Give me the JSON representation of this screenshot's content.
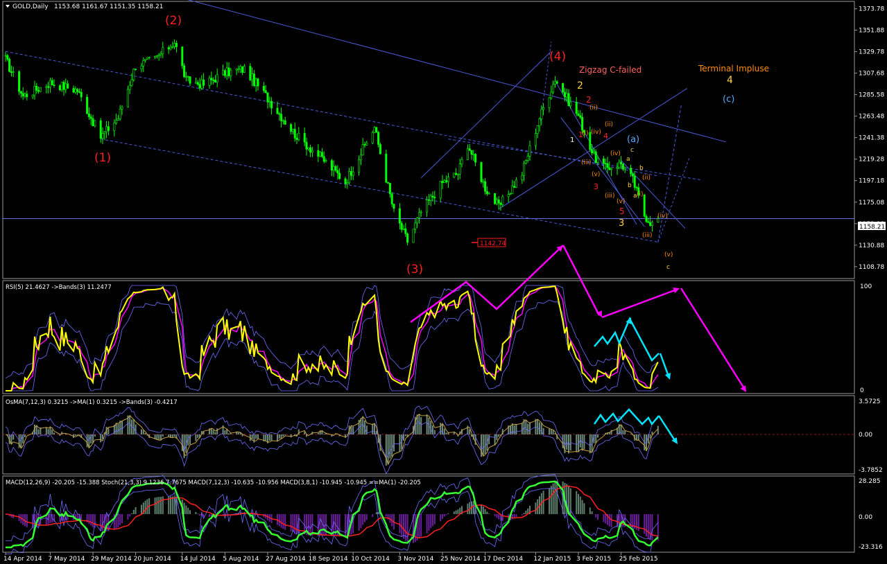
{
  "symbol_label": "GOLD,Daily",
  "ohlc_label": "1153.68 1161.67 1151.35 1158.21",
  "colors": {
    "bull": "#00ff00",
    "bear": "#00ff00",
    "channel": "#4a5bd6",
    "rsi": "#ffff00",
    "rsi_ma": "#ff00ff",
    "bands": "#6f6fff",
    "cyan": "#00e5ff",
    "magenta": "#ff00ff",
    "wave_red": "#ff0000",
    "wave_orange": "#ff8c00",
    "wave_yellow": "#ffd23f",
    "wave_blue": "#55aaff",
    "macd_green": "#33ff33",
    "macd_red": "#ff2020"
  },
  "chart_data": [
    {
      "type": "candlestick",
      "name": "price",
      "ylim": [
        1098,
        1380
      ],
      "yticks": [
        "1373.78",
        "1351.88",
        "1329.78",
        "1307.68",
        "1285.58",
        "1263.48",
        "1241.38",
        "1219.28",
        "1197.18",
        "1175.08",
        "1152.98",
        "1130.88",
        "1108.78"
      ],
      "current_price_label": "1158.21",
      "current_price": 1158.21,
      "low_label": "1142.74",
      "low_value": 1142.74,
      "x_dates": [
        "14 Apr 2014",
        "7 May 2014",
        "29 May 2014",
        "20 Jun 2014",
        "14 Jul 2014",
        "5 Aug 2014",
        "27 Aug 2014",
        "18 Sep 2014",
        "10 Oct 2014",
        "3 Nov 2014",
        "25 Nov 2014",
        "17 Dec 2014",
        "12 Jan 2015",
        "3 Feb 2015",
        "25 Feb 2015"
      ],
      "anchors": [
        [
          "14 Apr 2014",
          1322
        ],
        [
          "23 Apr 2014",
          1284
        ],
        [
          "7 May 2014",
          1298
        ],
        [
          "21 May 2014",
          1290
        ],
        [
          "2 Jun 2014",
          1242
        ],
        [
          "11 Jun 2014",
          1262
        ],
        [
          "20 Jun 2014",
          1316
        ],
        [
          "30 Jun 2014",
          1322
        ],
        [
          "10 Jul 2014",
          1340
        ],
        [
          "16 Jul 2014",
          1300
        ],
        [
          "25 Jul 2014",
          1296
        ],
        [
          "5 Aug 2014",
          1308
        ],
        [
          "15 Aug 2014",
          1312
        ],
        [
          "27 Aug 2014",
          1282
        ],
        [
          "10 Sep 2014",
          1245
        ],
        [
          "24 Sep 2014",
          1220
        ],
        [
          "6 Oct 2014",
          1196
        ],
        [
          "21 Oct 2014",
          1252
        ],
        [
          "31 Oct 2014",
          1165
        ],
        [
          "7 Nov 2014",
          1135
        ],
        [
          "14 Nov 2014",
          1165
        ],
        [
          "25 Nov 2014",
          1195
        ],
        [
          "3 Dec 2014",
          1205
        ],
        [
          "8 Dec 2014",
          1235
        ],
        [
          "17 Dec 2014",
          1190
        ],
        [
          "24 Dec 2014",
          1170
        ],
        [
          "5 Jan 2015",
          1205
        ],
        [
          "14 Jan 2015",
          1262
        ],
        [
          "22 Jan 2015",
          1302
        ],
        [
          "28 Jan 2015",
          1282
        ],
        [
          "3 Feb 2015",
          1264
        ],
        [
          "11 Feb 2015",
          1222
        ],
        [
          "17 Feb 2015",
          1210
        ],
        [
          "25 Feb 2015",
          1215
        ],
        [
          "3 Mar 2015",
          1198
        ],
        [
          "9 Mar 2015",
          1162
        ],
        [
          "13 Mar 2015",
          1153
        ],
        [
          "16 Mar 2015",
          1158
        ]
      ],
      "annotations": {
        "wave_1": "(1)",
        "wave_2": "(2)",
        "wave_3": "(3)",
        "wave_4": "(4)",
        "zigzag": "Zigzag C-failed",
        "terminal": "Terminal Impluse",
        "terminal_4": "4",
        "wave_a": "(a)",
        "wave_c": "(c)",
        "small_2_yellow": "2",
        "small_2_red": "2",
        "small_ii": "(ii)",
        "small_1_white": "1",
        "small_i_a": "(i)",
        "small_1_red": "1",
        "small_iv_a": "(iv)",
        "small_ii_b": "(ii)",
        "small_4_red": "4",
        "small_c": "c",
        "small_iii_a": "(iii)",
        "small_a": "a",
        "small_iv_b": "(iv)",
        "small_v_a": "(v)",
        "small_b": "b",
        "small_ii_c": "(ii)",
        "small_3_red": "3",
        "small_iii_b": "(iii)",
        "small_v_b": "(v)",
        "small_b2": "b",
        "small_i_b": "(i)",
        "small_a2": "a",
        "small_5_red": "5",
        "small_3_yellow": "3",
        "small_iv_c": "(iv)",
        "small_iii_c": "(iii)",
        "small_v_c": "(v)",
        "small_c2": "c"
      }
    },
    {
      "type": "line",
      "name": "rsi",
      "label": "RSI(5) 21.4627  ->Bands(3) 11.2477",
      "ylim": [
        0,
        100
      ],
      "yticks": [
        "100",
        "0"
      ]
    },
    {
      "type": "bar",
      "name": "osma",
      "label": "OsMA(7,12,3) 0.3215  ->MA(1) 0.3215  ->Bands(3) -0.4217",
      "ylim": [
        -3.7852,
        3.5725
      ],
      "yticks": [
        "3.5725",
        "0.00",
        "-3.7852"
      ]
    },
    {
      "type": "bar",
      "name": "macd",
      "label": "MACD(12,26,9) -20.205 -15.388  Stoch(21,3,3) 9.1236 7.7675  MACD(7,12,3) -10.635 -10.956  MACD(3,8,1) -10.945 -10.945  ==MA(1) -20.205",
      "ylim": [
        -23.316,
        28.285
      ],
      "yticks": [
        "28.285",
        "0.00",
        "-23.316"
      ]
    }
  ]
}
